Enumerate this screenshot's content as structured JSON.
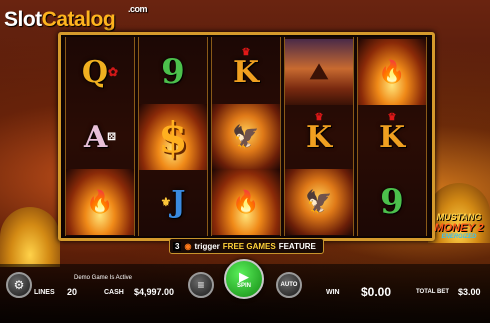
{
  "logo": {
    "slot": "Slot",
    "catalog": "Catalog",
    "com": ".com"
  },
  "reels": [
    [
      {
        "text": "Q",
        "icon": "rose-icon"
      },
      {
        "text": "A",
        "icon": "dice-icon"
      },
      {
        "icon": "gold-fire-icon"
      }
    ],
    [
      {
        "text": "9"
      },
      {
        "text": "$",
        "icon": "dollar-icon"
      },
      {
        "text": "J",
        "icon": "fleur-de-lis-icon"
      }
    ],
    [
      {
        "text": "K",
        "icon": "crown-icon"
      },
      {
        "icon": "eagle-icon"
      },
      {
        "icon": "gold-fire-icon"
      }
    ],
    [
      {
        "icon": "canyon-icon"
      },
      {
        "text": "K",
        "icon": "crown-icon"
      },
      {
        "icon": "eagle-icon"
      }
    ],
    [
      {
        "icon": "gold-fire-icon"
      },
      {
        "text": "K",
        "icon": "crown-icon"
      },
      {
        "text": "9"
      }
    ]
  ],
  "trigger": {
    "count": "3",
    "word": "trigger",
    "feature": "FREE GAMES",
    "suffix": "FEATURE"
  },
  "game_logo": {
    "line1": "MUSTANG",
    "line2": "MONEY 2",
    "line3": "ENERGIZED"
  },
  "controls": {
    "demo_message": "Demo Game Is Active",
    "lines_label": "LINES",
    "lines_value": "20",
    "cash_label": "CASH",
    "cash_value": "$4,997.00",
    "spin_label": "SPIN",
    "auto_label": "AUTO",
    "win_label": "WIN",
    "win_value": "$0.00",
    "total_bet_label": "TOTAL BET",
    "total_bet_value": "$3.00"
  }
}
